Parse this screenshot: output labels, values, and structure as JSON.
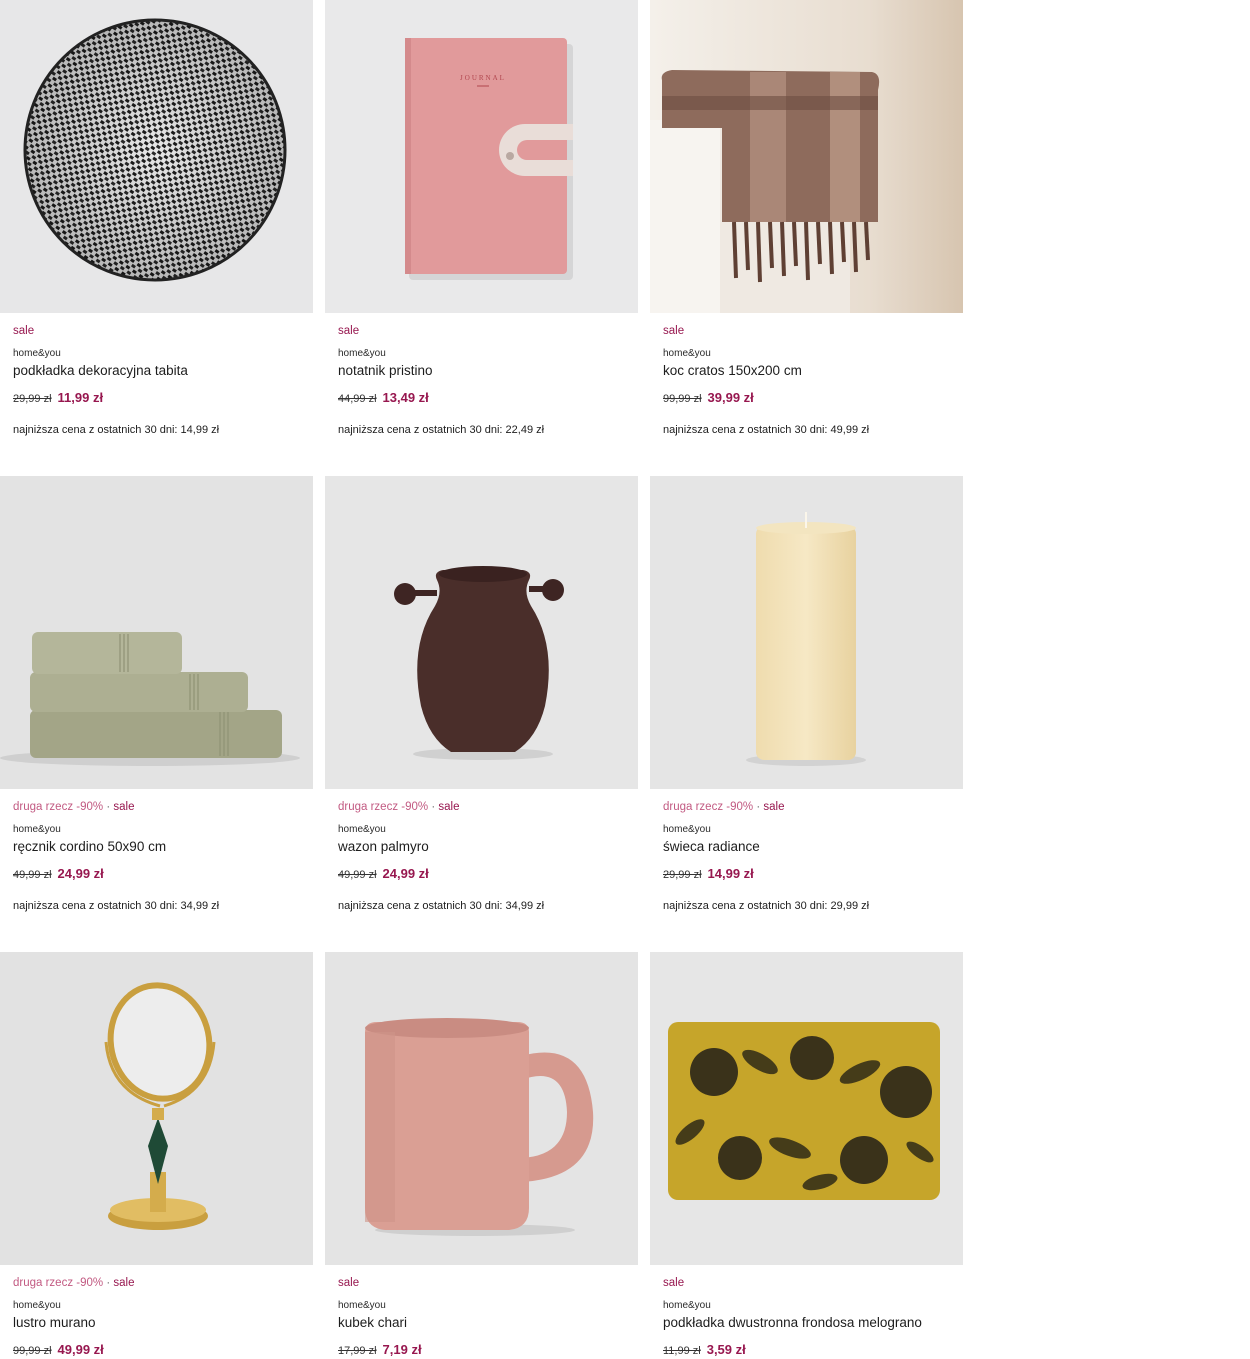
{
  "products": [
    {
      "promo": "",
      "sale": "sale",
      "brand": "home&you",
      "name": "podkładka dekoracyjna tabita",
      "old_price": "29,99 zł",
      "new_price": "11,99 zł",
      "lowest_price": "najniższa cena z ostatnich 30 dni: 14,99 zł",
      "image_icon": "round-placemat-icon"
    },
    {
      "promo": "",
      "sale": "sale",
      "brand": "home&you",
      "name": "notatnik pristino",
      "old_price": "44,99 zł",
      "new_price": "13,49 zł",
      "lowest_price": "najniższa cena z ostatnich 30 dni: 22,49 zł",
      "image_icon": "notebook-icon",
      "image_text": "JOURNAL"
    },
    {
      "promo": "",
      "sale": "sale",
      "brand": "home&you",
      "name": "koc cratos 150x200 cm",
      "old_price": "99,99 zł",
      "new_price": "39,99 zł",
      "lowest_price": "najniższa cena z ostatnich 30 dni: 49,99 zł",
      "image_icon": "blanket-icon"
    },
    {
      "promo": "druga rzecz -90%",
      "sale": "sale",
      "brand": "home&you",
      "name": "ręcznik cordino 50x90 cm",
      "old_price": "49,99 zł",
      "new_price": "24,99 zł",
      "lowest_price": "najniższa cena z ostatnich 30 dni: 34,99 zł",
      "image_icon": "towels-icon"
    },
    {
      "promo": "druga rzecz -90%",
      "sale": "sale",
      "brand": "home&you",
      "name": "wazon palmyro",
      "old_price": "49,99 zł",
      "new_price": "24,99 zł",
      "lowest_price": "najniższa cena z ostatnich 30 dni: 34,99 zł",
      "image_icon": "vase-icon"
    },
    {
      "promo": "druga rzecz -90%",
      "sale": "sale",
      "brand": "home&you",
      "name": "świeca radiance",
      "old_price": "29,99 zł",
      "new_price": "14,99 zł",
      "lowest_price": "najniższa cena z ostatnich 30 dni: 29,99 zł",
      "image_icon": "candle-icon"
    },
    {
      "promo": "druga rzecz -90%",
      "sale": "sale",
      "brand": "home&you",
      "name": "lustro murano",
      "old_price": "99,99 zł",
      "new_price": "49,99 zł",
      "lowest_price": "",
      "image_icon": "mirror-icon"
    },
    {
      "promo": "",
      "sale": "sale",
      "brand": "home&you",
      "name": "kubek chari",
      "old_price": "17,99 zł",
      "new_price": "7,19 zł",
      "lowest_price": "",
      "image_icon": "mug-icon"
    },
    {
      "promo": "",
      "sale": "sale",
      "brand": "home&you",
      "name": "podkładka dwustronna frondosa melograno",
      "old_price": "11,99 zł",
      "new_price": "3,59 zł",
      "lowest_price": "",
      "image_icon": "pomegranate-placemat-icon"
    }
  ],
  "separator": "·",
  "colors": {
    "sale": "#97174f",
    "promo": "#c25a82",
    "background": "#ffffff",
    "photo_background": "#e4e4e4"
  }
}
